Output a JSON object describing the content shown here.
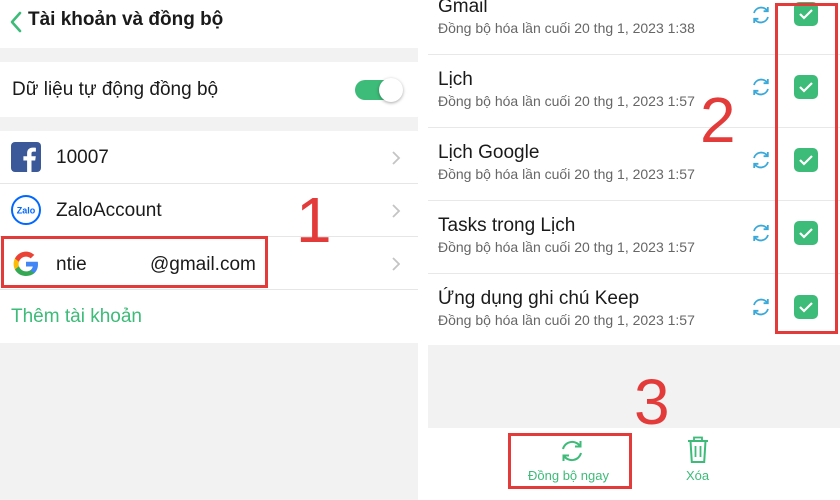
{
  "left": {
    "title": "Tài khoản và đồng bộ",
    "auto_sync_label": "Dữ liệu tự động đồng bộ",
    "accounts": [
      {
        "label": "10007",
        "icon": "facebook-icon"
      },
      {
        "label": "ZaloAccount",
        "icon": "zalo-icon",
        "icon_text": "Zalo"
      },
      {
        "label": "ntie            @gmail.com",
        "icon": "google-icon"
      }
    ],
    "add_account_label": "Thêm tài khoản"
  },
  "right": {
    "items": [
      {
        "name": "Gmail",
        "time": "Đồng bộ hóa lần cuối 20 thg 1, 2023 1:38"
      },
      {
        "name": "Lịch",
        "time": "Đồng bộ hóa lần cuối 20 thg 1, 2023 1:57"
      },
      {
        "name": "Lịch Google",
        "time": "Đồng bộ hóa lần cuối 20 thg 1, 2023 1:57"
      },
      {
        "name": "Tasks trong Lịch",
        "time": "Đồng bộ hóa lần cuối 20 thg 1, 2023 1:57"
      },
      {
        "name": "Ứng dụng ghi chú Keep",
        "time": "Đồng bộ hóa lần cuối 20 thg 1, 2023 1:57"
      }
    ],
    "sync_now_label": "Đồng bộ ngay",
    "delete_label": "Xóa"
  },
  "annotations": {
    "step1": "1",
    "step2": "2",
    "step3": "3"
  },
  "colors": {
    "accent": "#3dbb78",
    "annotation": "#e33a3a",
    "facebook": "#3b5998",
    "zalo": "#0068ff"
  }
}
